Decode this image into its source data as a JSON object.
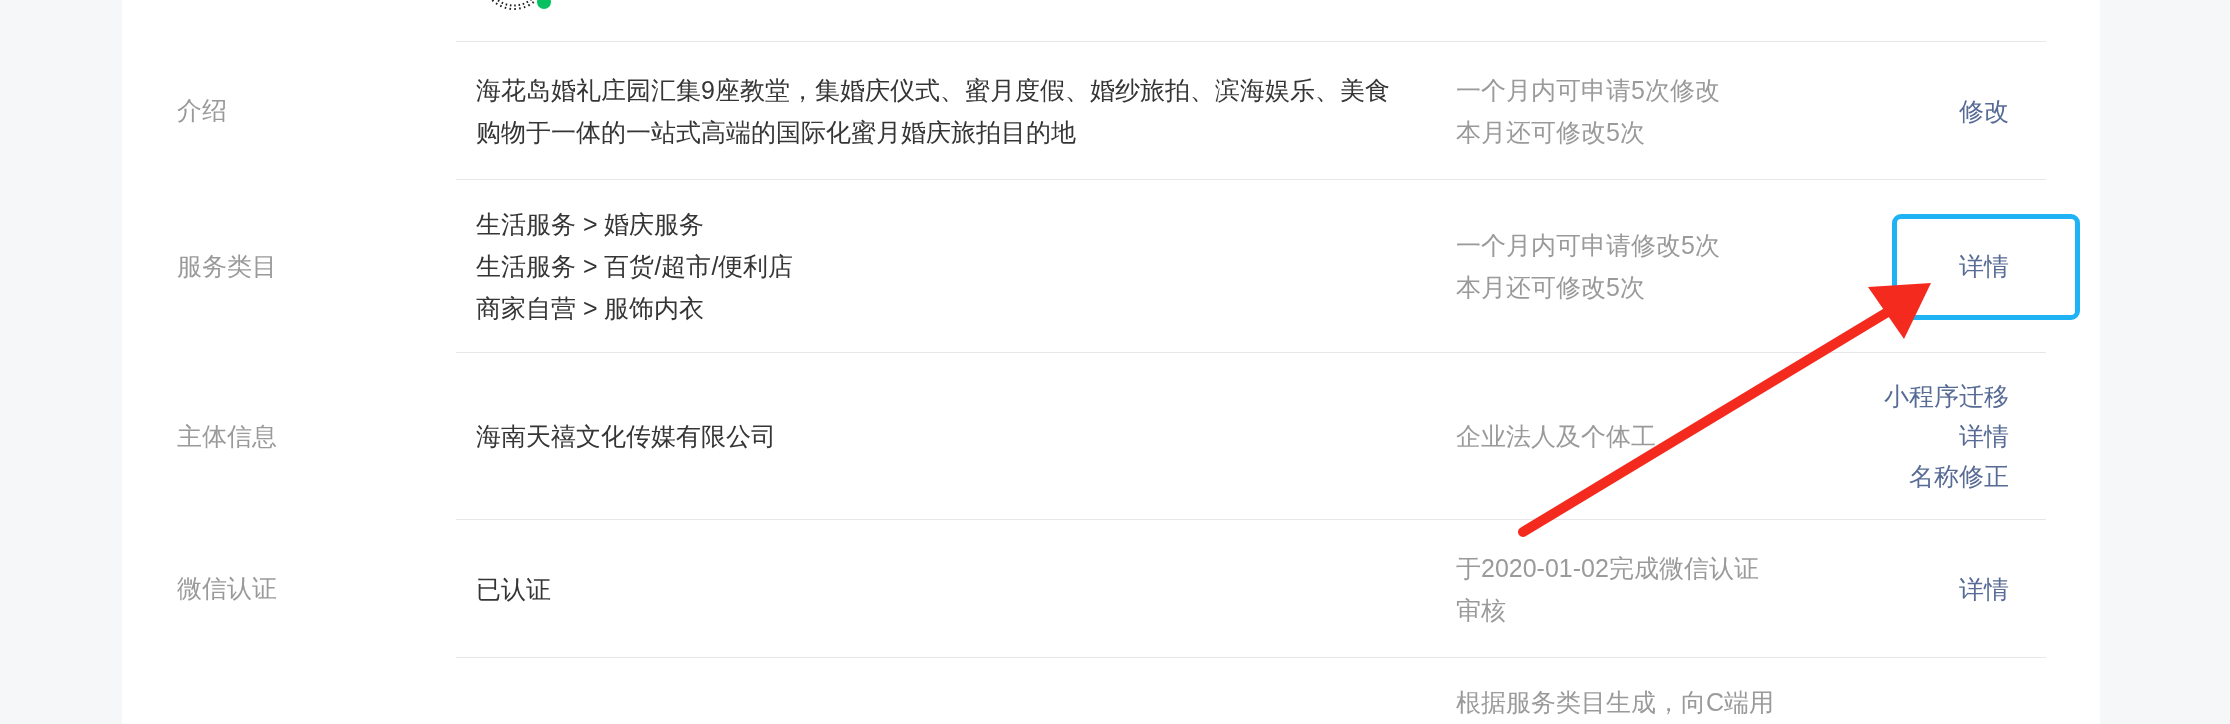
{
  "rows": [
    {
      "kind": "code"
    },
    {
      "kind": "info",
      "label": "介绍",
      "value_lines": [
        "海花岛婚礼庄园汇集9座教堂，集婚庆仪式、蜜月度假、婚纱旅拍、滨海娱乐、美食购物于一体的一站式高端的国际化蜜月婚庆旅拍目的地"
      ],
      "note_lines": [
        "一个月内可申请5次修改",
        "本月还可修改5次"
      ],
      "actions": [
        {
          "label": "修改",
          "highlighted": false
        }
      ]
    },
    {
      "kind": "info",
      "label": "服务类目",
      "value_lines": [
        "生活服务 > 婚庆服务",
        "生活服务 > 百货/超市/便利店",
        "商家自营 > 服饰内衣"
      ],
      "note_lines": [
        "一个月内可申请修改5次",
        "本月还可修改5次"
      ],
      "actions": [
        {
          "label": "详情",
          "highlighted": true
        }
      ]
    },
    {
      "kind": "info",
      "label": "主体信息",
      "value_lines": [
        "海南天禧文化传媒有限公司"
      ],
      "note_lines": [
        "企业法人及个体工"
      ],
      "actions": [
        {
          "label": "小程序迁移",
          "highlighted": false
        },
        {
          "label": "详情",
          "highlighted": false
        },
        {
          "label": "名称修正",
          "highlighted": false
        }
      ]
    },
    {
      "kind": "info",
      "label": "微信认证",
      "value_lines": [
        "已认证"
      ],
      "note_lines": [
        "于2020-01-02完成微信认证审核"
      ],
      "actions": [
        {
          "label": "详情",
          "highlighted": false
        }
      ]
    },
    {
      "kind": "info",
      "note_lines": [
        "根据服务类目生成，向C端用"
      ]
    }
  ]
}
